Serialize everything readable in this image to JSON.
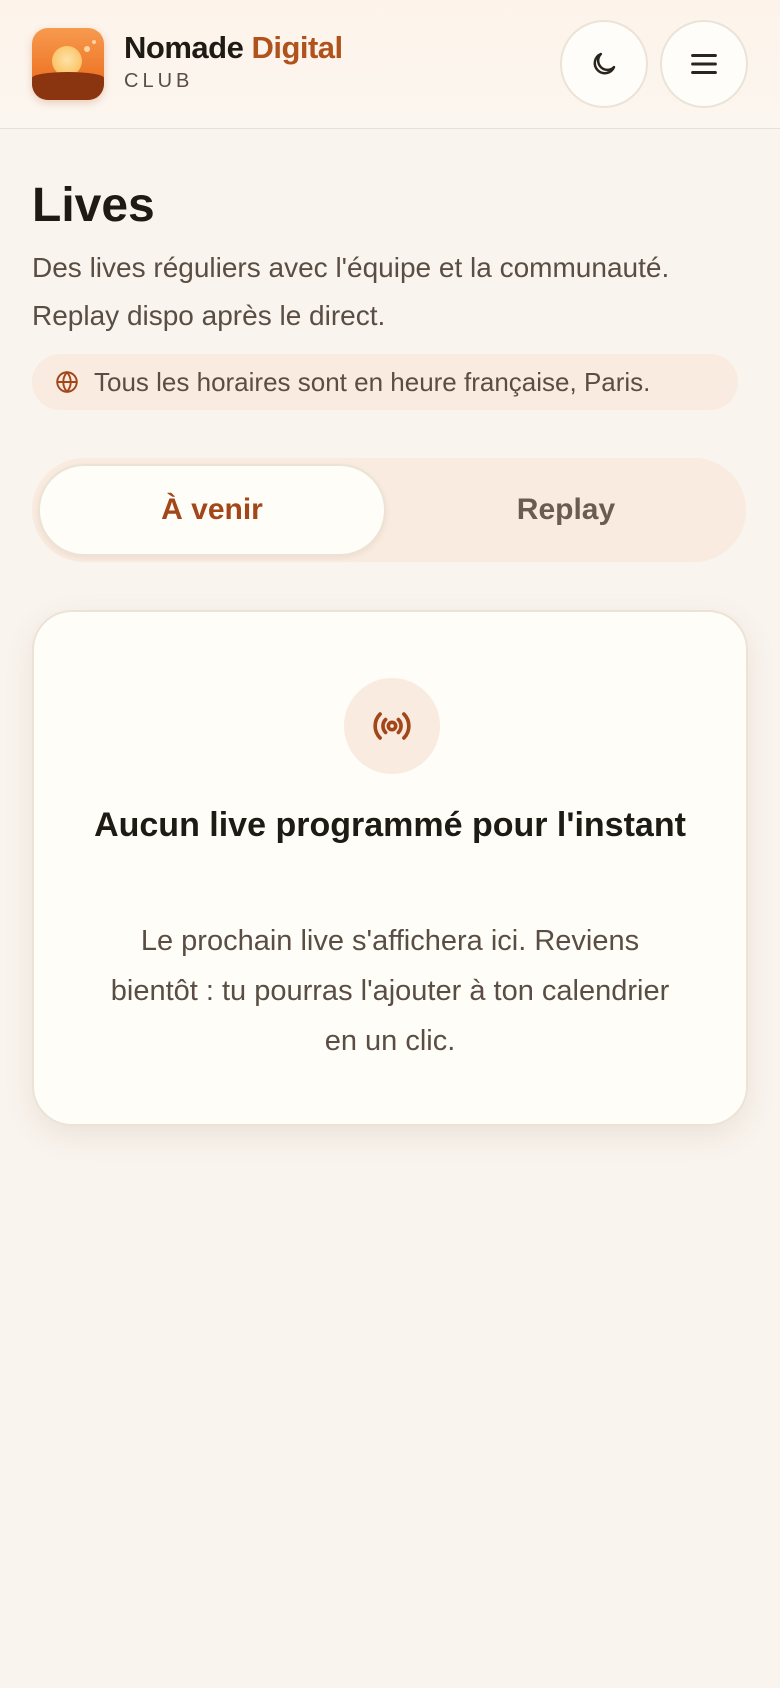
{
  "header": {
    "brand_name_part1": "Nomade",
    "brand_name_part2": "Digital",
    "brand_sub": "CLUB",
    "logo_icon": "sunset-logo-icon",
    "theme_toggle_icon": "moon-icon",
    "menu_icon": "hamburger-menu-icon"
  },
  "page": {
    "title": "Lives",
    "description": "Des lives réguliers avec l'équipe et la communauté. Replay dispo après le direct.",
    "timezone_note": "Tous les horaires sont en heure française, Paris.",
    "timezone_icon": "globe-icon"
  },
  "tabs": {
    "upcoming_label": "À venir",
    "replay_label": "Replay",
    "active": "upcoming"
  },
  "empty_state": {
    "icon": "broadcast-icon",
    "title": "Aucun live programmé pour l'instant",
    "description": "Le prochain live s'affichera ici. Reviens bientôt : tu pourras l'ajouter à ton calendrier en un clic."
  },
  "colors": {
    "accent": "#b0521c",
    "accent_dark": "#a3461a",
    "background": "#f9f4ee",
    "pill_bg": "#f9ebdf",
    "card_bg": "#fffdf8",
    "text_primary": "#1e1a14",
    "text_secondary": "#5a4e44"
  }
}
